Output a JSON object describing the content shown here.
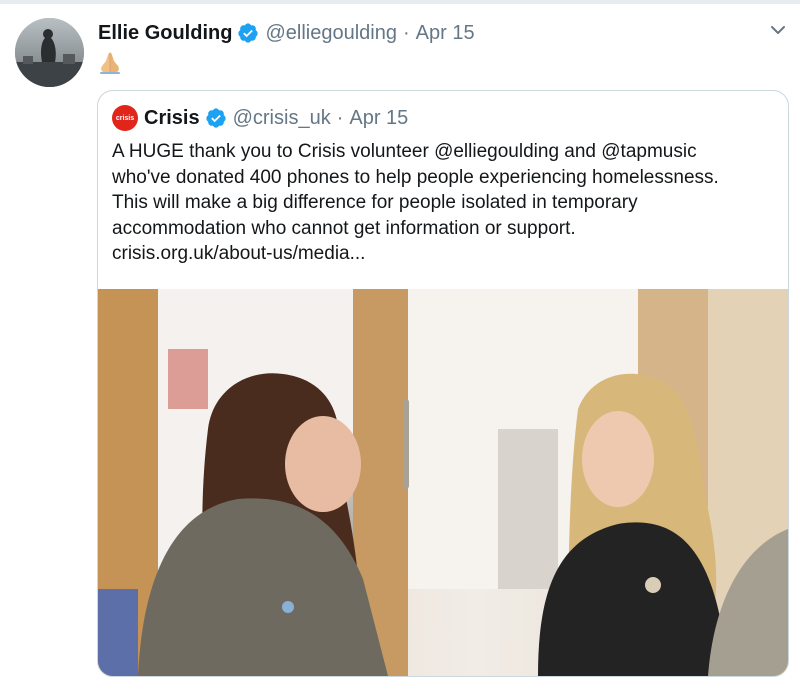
{
  "tweet": {
    "author_name": "Ellie Goulding",
    "handle": "@elliegoulding",
    "separator": "·",
    "date": "Apr 15",
    "text": "🙏🏼"
  },
  "quoted_tweet": {
    "author_name": "Crisis",
    "logo_text": "crisis",
    "handle": "@crisis_uk",
    "separator": "·",
    "date": "Apr 15",
    "lines": [
      "A HUGE thank you to Crisis volunteer @elliegoulding and @tapmusic",
      " who've donated 400 phones to help people experiencing homelessness.",
      "This will make a big difference for people isolated in temporary",
      "accommodation who cannot get  information  or support.",
      "crisis.org.uk/about-us/media..."
    ]
  },
  "colors": {
    "verified": "#1da1f2",
    "secondary_text": "#657786",
    "crisis_red": "#e1251b",
    "border": "#ccd6dd"
  },
  "icons": {
    "verified": "verified-badge-icon",
    "menu": "chevron-down-icon",
    "emoji": "praying-hands-emoji"
  }
}
